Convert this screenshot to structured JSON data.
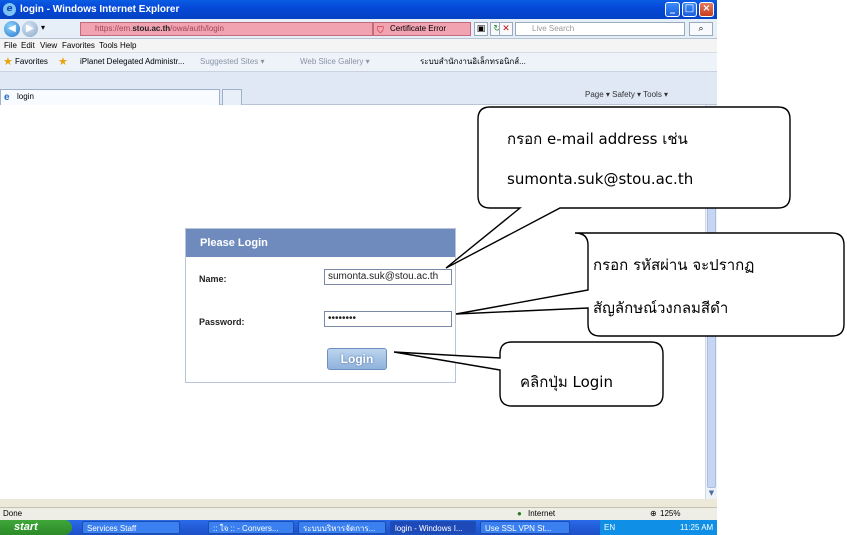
{
  "window": {
    "title": "login - Windows Internet Explorer",
    "controls": [
      "_",
      "□",
      "×"
    ]
  },
  "addressbar": {
    "url_host": "stou.ac.th",
    "url_prefix": "https://em.",
    "url_suffix": "/owa/auth/login",
    "cert_error": "Certificate Error",
    "search_placeholder": "Live Search"
  },
  "menu": [
    "File",
    "Edit",
    "View",
    "Favorites",
    "Tools",
    "Help"
  ],
  "favorites": {
    "label": "Favorites",
    "items": [
      "iPlanet Delegated Administr...",
      "Suggested Sites ▾",
      "Web Slice Gallery ▾",
      "ระบบสำนักงานอิเล็กทรอนิกส์..."
    ]
  },
  "tab": {
    "label": "login"
  },
  "command_bar": "Page ▾  Safety ▾  Tools ▾",
  "login": {
    "header": "Please Login",
    "name_label": "Name:",
    "name_value": "sumonta.suk@stou.ac.th",
    "password_label": "Password:",
    "password_value": "••••••••",
    "button": "Login"
  },
  "status": {
    "left": "Done",
    "zone": "Internet",
    "zoom": "125%"
  },
  "taskbar": {
    "start": "start",
    "items": [
      "Services Staff",
      ":: ใจ :: - Convers...",
      "ระบบบริหารจัดการ...",
      "login - Windows I...",
      "Use SSL VPN St..."
    ],
    "tray_lang": "EN",
    "clock": "11:25 AM"
  },
  "callouts": {
    "email": {
      "line1": "กรอก e-mail address เช่น",
      "line2": "sumonta.suk@stou.ac.th"
    },
    "password": {
      "line1": "กรอก รหัสผ่าน จะปรากฏ",
      "line2": "สัญลักษณ์วงกลมสีดำ"
    },
    "button": {
      "line1": "คลิกปุ่ม Login"
    }
  }
}
